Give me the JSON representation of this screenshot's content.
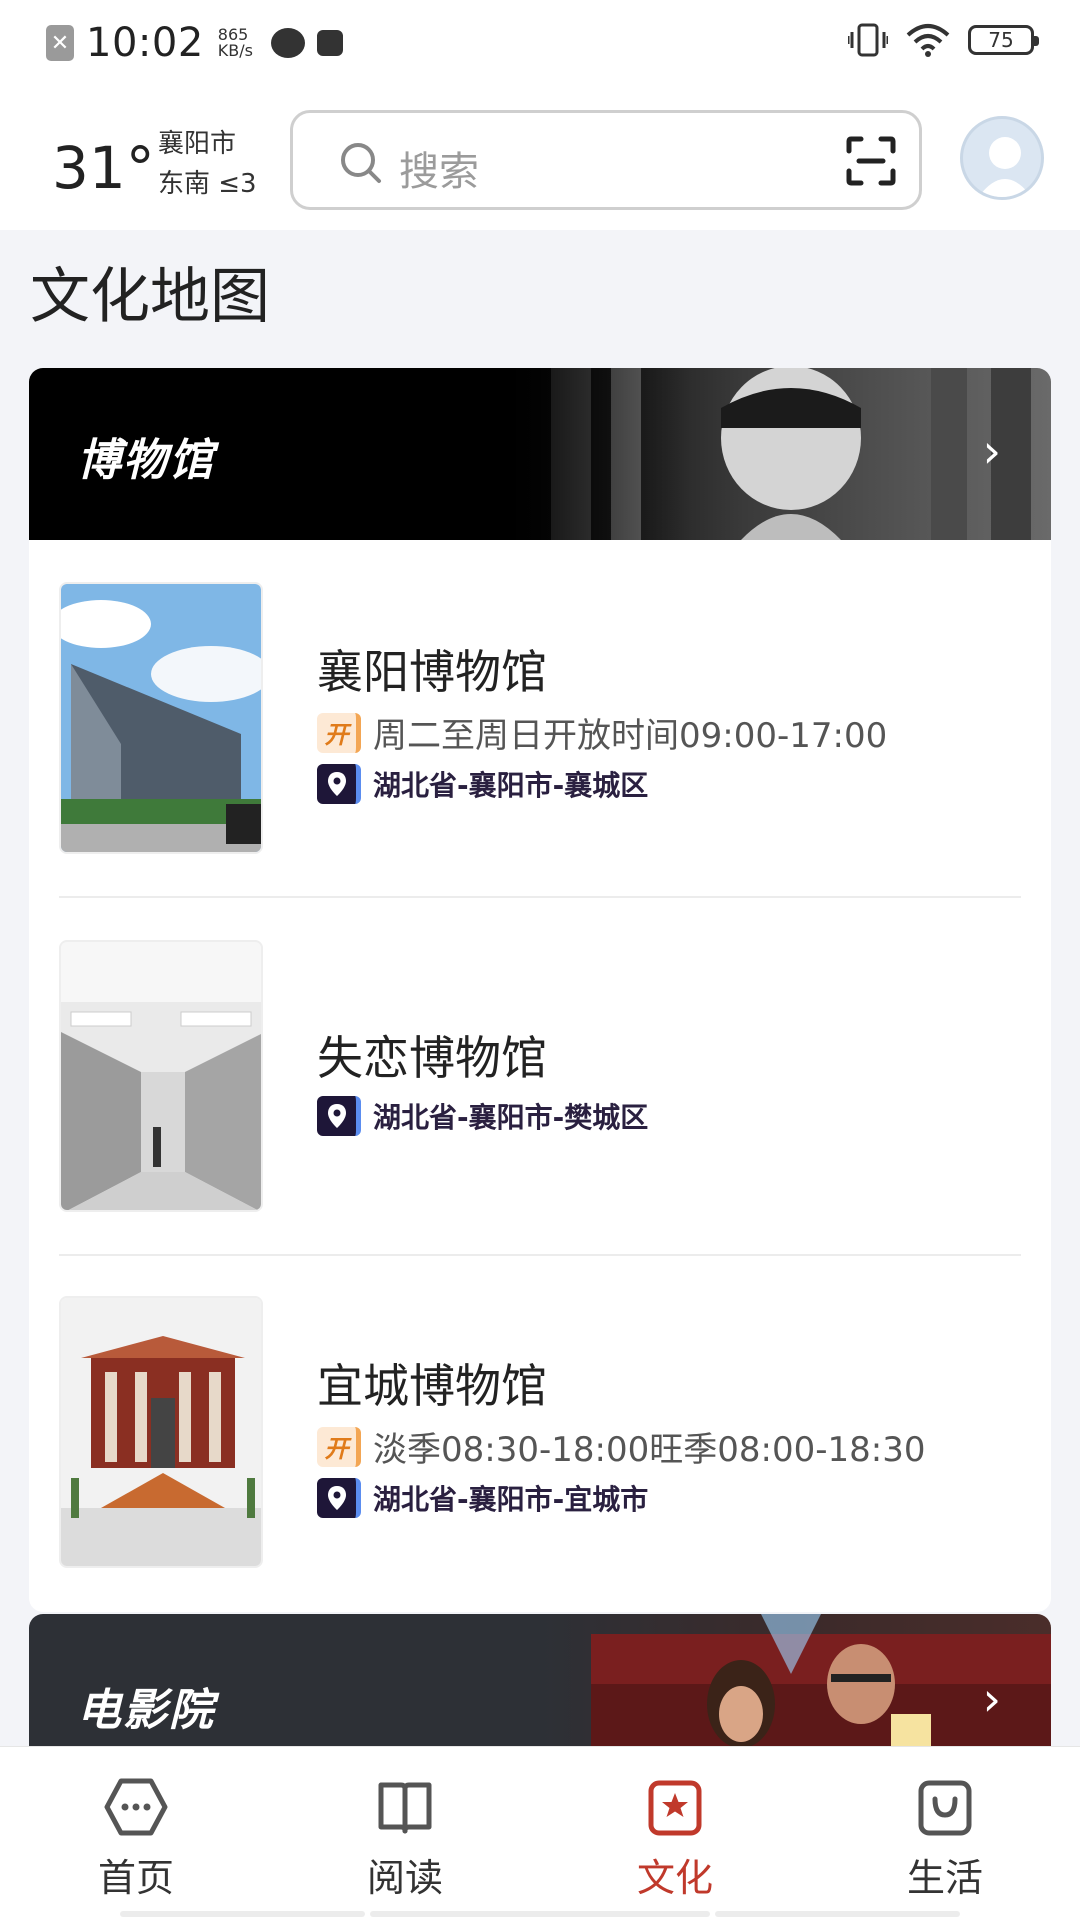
{
  "status_bar": {
    "time": "10:02",
    "speed_value": "865",
    "speed_unit": "KB/s",
    "battery": "75"
  },
  "header": {
    "temperature": "31°",
    "city": "襄阳市",
    "wind": "东南 ≤3",
    "search_placeholder": "搜索"
  },
  "page_title": "文化地图",
  "museum_section": {
    "title": "博物馆",
    "items": [
      {
        "name": "襄阳博物馆",
        "hours": "周二至周日开放时间09:00-17:00",
        "address": "湖北省-襄阳市-襄城区"
      },
      {
        "name": "失恋博物馆",
        "address": "湖北省-襄阳市-樊城区"
      },
      {
        "name": "宜城博物馆",
        "hours": "淡季08:30-18:00旺季08:00-18:30",
        "address": "湖北省-襄阳市-宜城市"
      }
    ],
    "open_badge": "开"
  },
  "cinema_section": {
    "title": "电影院"
  },
  "bottom_nav": {
    "items": [
      {
        "label": "首页",
        "icon": "home-hexagon-icon"
      },
      {
        "label": "阅读",
        "icon": "book-icon"
      },
      {
        "label": "文化",
        "icon": "star-badge-icon"
      },
      {
        "label": "生活",
        "icon": "bag-icon"
      }
    ],
    "active": "文化",
    "active_color": "#c0392b"
  }
}
